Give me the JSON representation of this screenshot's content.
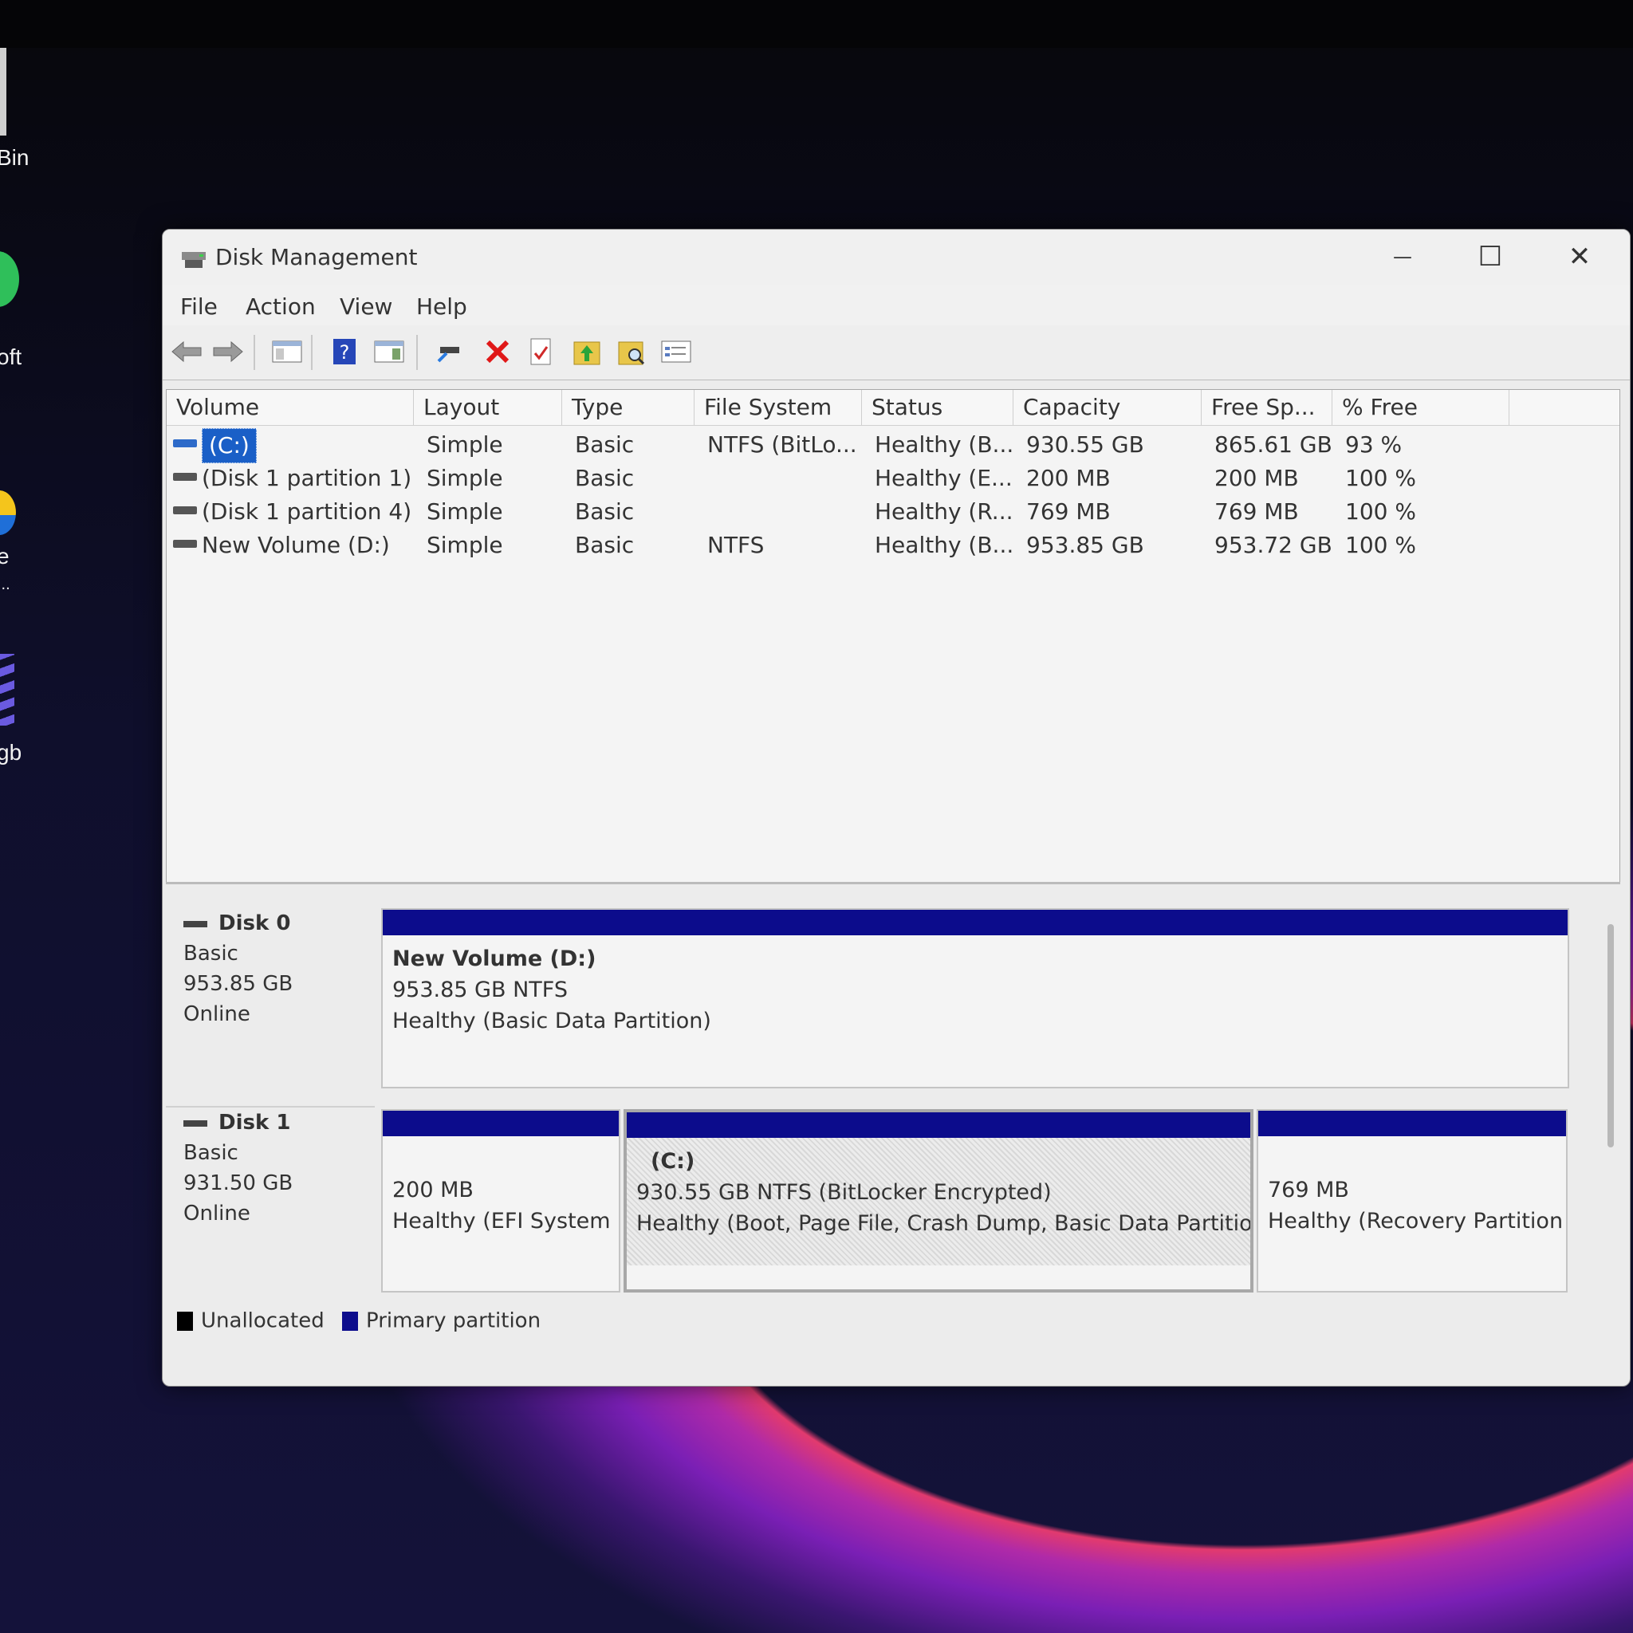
{
  "desktop": {
    "icon_labels": [
      "Bin",
      "oft",
      "e",
      "...",
      "gb"
    ]
  },
  "window": {
    "title": "Disk Management",
    "controls": {
      "minimize": "—",
      "maximize": "☐",
      "close": "✕"
    }
  },
  "menu": {
    "file": "File",
    "action": "Action",
    "view": "View",
    "help": "Help"
  },
  "toolbar": {
    "icons": [
      "back-arrow-icon",
      "forward-arrow-icon",
      "console-tree-icon",
      "help-icon",
      "action-pane-icon",
      "connect-disk-icon",
      "delete-icon",
      "properties-icon",
      "folder-up-icon",
      "search-folder-icon",
      "settings-view-icon"
    ]
  },
  "volume_list": {
    "columns": [
      "Volume",
      "Layout",
      "Type",
      "File System",
      "Status",
      "Capacity",
      "Free Sp...",
      "% Free"
    ],
    "rows": [
      {
        "volume": "(C:)",
        "layout": "Simple",
        "type": "Basic",
        "fs": "NTFS (BitLo...",
        "status": "Healthy (B...",
        "capacity": "930.55 GB",
        "free": "865.61 GB",
        "pct": "93 %"
      },
      {
        "volume": "(Disk 1 partition 1)",
        "layout": "Simple",
        "type": "Basic",
        "fs": "",
        "status": "Healthy (E...",
        "capacity": "200 MB",
        "free": "200 MB",
        "pct": "100 %"
      },
      {
        "volume": "(Disk 1 partition 4)",
        "layout": "Simple",
        "type": "Basic",
        "fs": "",
        "status": "Healthy (R...",
        "capacity": "769 MB",
        "free": "769 MB",
        "pct": "100 %"
      },
      {
        "volume": "New Volume (D:)",
        "layout": "Simple",
        "type": "Basic",
        "fs": "NTFS",
        "status": "Healthy (B...",
        "capacity": "953.85 GB",
        "free": "953.72 GB",
        "pct": "100 %"
      }
    ]
  },
  "disks": {
    "disk0": {
      "name": "Disk 0",
      "type": "Basic",
      "size": "953.85 GB",
      "state": "Online",
      "partitions": [
        {
          "title": "New Volume  (D:)",
          "line1": "953.85 GB NTFS",
          "line2": "Healthy (Basic Data Partition)"
        }
      ]
    },
    "disk1": {
      "name": "Disk 1",
      "type": "Basic",
      "size": "931.50 GB",
      "state": "Online",
      "partitions": [
        {
          "title": "",
          "line1": "200 MB",
          "line2": "Healthy (EFI System I"
        },
        {
          "title": "(C:)",
          "line1": "930.55 GB NTFS (BitLocker Encrypted)",
          "line2": "Healthy (Boot, Page File, Crash Dump, Basic Data Partition)"
        },
        {
          "title": "",
          "line1": "769 MB",
          "line2": "Healthy (Recovery Partition"
        }
      ]
    }
  },
  "legend": {
    "unallocated": "Unallocated",
    "primary": "Primary partition",
    "colors": {
      "unallocated": "#000000",
      "primary": "#0c0c8c"
    }
  }
}
